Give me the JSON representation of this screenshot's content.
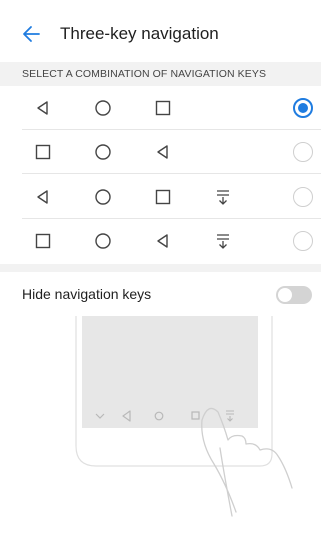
{
  "header": {
    "title": "Three-key navigation",
    "back_icon": "arrow-left-icon",
    "accent_color": "#1f7ce0"
  },
  "section": {
    "label": "SELECT A COMBINATION OF NAVIGATION KEYS"
  },
  "options": [
    {
      "keys": [
        "back-triangle-icon",
        "home-circle-icon",
        "recent-square-icon"
      ],
      "selected": true
    },
    {
      "keys": [
        "recent-square-icon",
        "home-circle-icon",
        "back-triangle-icon"
      ],
      "selected": false
    },
    {
      "keys": [
        "back-triangle-icon",
        "home-circle-icon",
        "recent-square-icon",
        "notification-pulldown-icon"
      ],
      "selected": false
    },
    {
      "keys": [
        "recent-square-icon",
        "home-circle-icon",
        "back-triangle-icon",
        "notification-pulldown-icon"
      ],
      "selected": false
    }
  ],
  "hide_keys": {
    "label": "Hide navigation keys",
    "enabled": false
  },
  "illustration": {
    "nav_keys": [
      "chevron-down-icon",
      "back-triangle-icon",
      "home-circle-icon",
      "recent-square-icon",
      "notification-pulldown-icon"
    ],
    "icon": "hand-swipe-icon"
  }
}
